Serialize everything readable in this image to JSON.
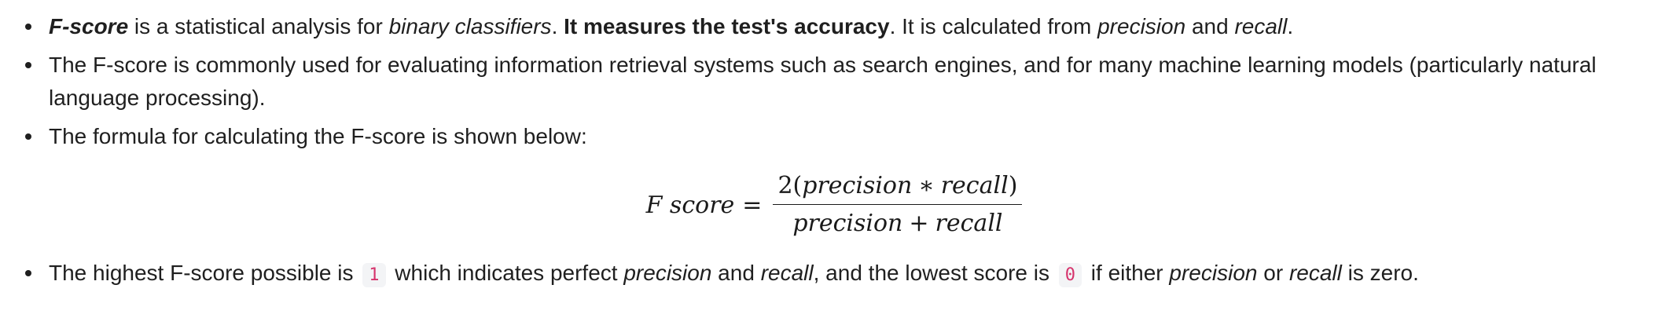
{
  "bullets": {
    "item1": {
      "term": "F-score",
      "text1": " is a statistical analysis for ",
      "em1": "binary classifiers",
      "text2": ". ",
      "strong": "It measures the test's accuracy",
      "text3": ". It is calculated from ",
      "em2": "precision",
      "text4": " and ",
      "em3": "recall",
      "text5": "."
    },
    "item2": {
      "text": "The F-score is commonly used for evaluating information retrieval systems such as search engines, and for many machine learning models (particularly natural language processing)."
    },
    "item3": {
      "text": "The formula for calculating the F-score is shown below:"
    },
    "item4": {
      "text1": "The highest F-score possible is ",
      "code1": "1",
      "text2": " which indicates perfect ",
      "em1": "precision",
      "text3": " and ",
      "em2": "recall",
      "text4": ", and the lowest score is ",
      "code2": "0",
      "text5": " if either ",
      "em3": "precision",
      "text6": " or ",
      "em4": "recall",
      "text7": " is zero."
    }
  },
  "formula": {
    "lhs": "F score",
    "equals": "=",
    "num_coef": "2(",
    "num_var1": "precision",
    "num_op": "∗",
    "num_var2": "recall",
    "num_close": ")",
    "den_var1": "precision",
    "den_op": "+",
    "den_var2": "recall"
  }
}
